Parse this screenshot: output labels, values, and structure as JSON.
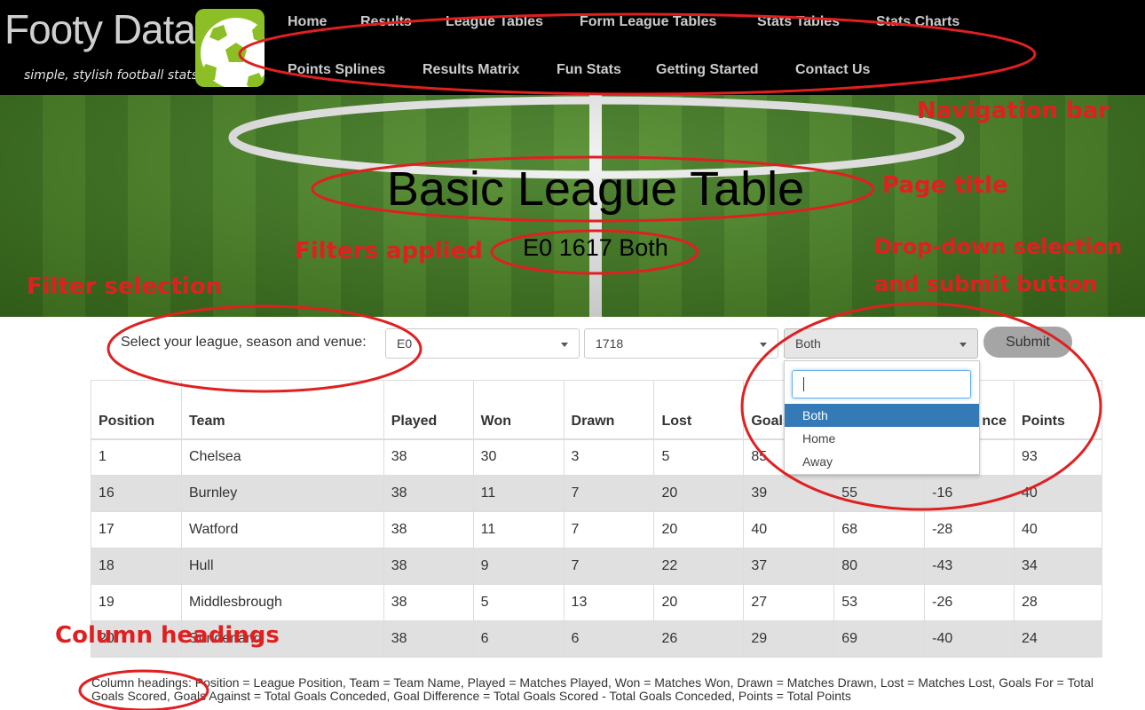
{
  "brand": {
    "name": "Footy Data",
    "tagline": "simple, stylish football stats"
  },
  "nav": {
    "row1": [
      "Home",
      "Results",
      "League Tables",
      "Form League Tables",
      "Stats Tables",
      "Stats Charts"
    ],
    "row2": [
      "Points Splines",
      "Results Matrix",
      "Fun Stats",
      "Getting Started",
      "Contact Us"
    ]
  },
  "page": {
    "title": "Basic League Table",
    "subtitle": "E0 1617 Both"
  },
  "filters": {
    "label": "Select your league, season and venue:",
    "league": "E0",
    "season": "1718",
    "venue": "Both",
    "submit_label": "Submit"
  },
  "dropdown": {
    "search_value": "",
    "options": [
      "Both",
      "Home",
      "Away"
    ],
    "selected": "Both"
  },
  "table": {
    "headers": [
      "Position",
      "Team",
      "Played",
      "Won",
      "Drawn",
      "Lost",
      "Goals",
      "",
      "nce",
      "Points"
    ],
    "rows": [
      [
        "1",
        "Chelsea",
        "38",
        "30",
        "3",
        "5",
        "85",
        "",
        "",
        "93"
      ],
      [
        "16",
        "Burnley",
        "38",
        "11",
        "7",
        "20",
        "39",
        "55",
        "-16",
        "40"
      ],
      [
        "17",
        "Watford",
        "38",
        "11",
        "7",
        "20",
        "40",
        "68",
        "-28",
        "40"
      ],
      [
        "18",
        "Hull",
        "38",
        "9",
        "7",
        "22",
        "37",
        "80",
        "-43",
        "34"
      ],
      [
        "19",
        "Middlesbrough",
        "38",
        "5",
        "13",
        "20",
        "27",
        "53",
        "-26",
        "28"
      ],
      [
        "20",
        "Sunderland",
        "38",
        "6",
        "6",
        "26",
        "29",
        "69",
        "-40",
        "24"
      ]
    ]
  },
  "footnote": "Column headings: Position = League Position, Team = Team Name, Played = Matches Played, Won = Matches Won, Drawn = Matches Drawn, Lost = Matches Lost, Goals For = Total Goals Scored, Goals Against = Total Goals Conceded, Goal Difference = Total Goals Scored - Total Goals Conceded, Points = Total Points",
  "annotations": {
    "color": "#e02020",
    "navigation_bar": "Navigation bar",
    "page_title": "Page title",
    "filters_applied": "Filters applied",
    "filter_selection": "Filter selection",
    "dropdown_line1": "Drop-down selection",
    "dropdown_line2": "and submit button",
    "column_headings": "Column headings"
  }
}
